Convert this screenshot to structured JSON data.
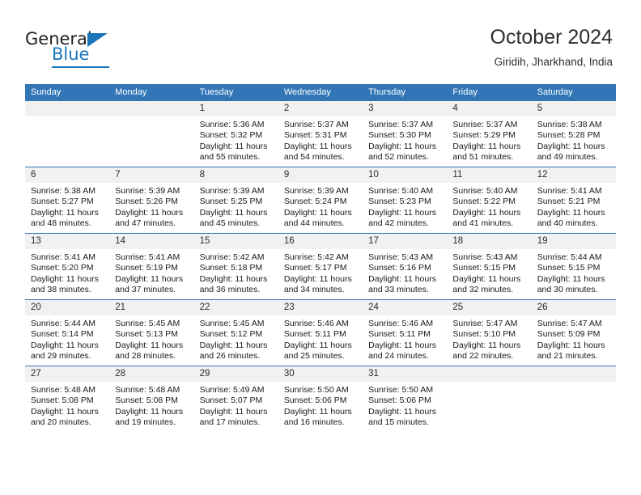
{
  "brand": {
    "name_top": "General",
    "name_bottom": "Blue",
    "accent_color": "#1b75bb"
  },
  "header": {
    "title": "October 2024",
    "subtitle": "Giridih, Jharkhand, India"
  },
  "calendar": {
    "header_bg": "#3276b8",
    "daynum_bg": "#f1f1f1",
    "weekday_headers": [
      "Sunday",
      "Monday",
      "Tuesday",
      "Wednesday",
      "Thursday",
      "Friday",
      "Saturday"
    ],
    "weeks": [
      [
        {
          "day": "",
          "sunrise": "",
          "sunset": "",
          "daylight_1": "",
          "daylight_2": ""
        },
        {
          "day": "",
          "sunrise": "",
          "sunset": "",
          "daylight_1": "",
          "daylight_2": ""
        },
        {
          "day": "1",
          "sunrise": "Sunrise: 5:36 AM",
          "sunset": "Sunset: 5:32 PM",
          "daylight_1": "Daylight: 11 hours",
          "daylight_2": "and 55 minutes."
        },
        {
          "day": "2",
          "sunrise": "Sunrise: 5:37 AM",
          "sunset": "Sunset: 5:31 PM",
          "daylight_1": "Daylight: 11 hours",
          "daylight_2": "and 54 minutes."
        },
        {
          "day": "3",
          "sunrise": "Sunrise: 5:37 AM",
          "sunset": "Sunset: 5:30 PM",
          "daylight_1": "Daylight: 11 hours",
          "daylight_2": "and 52 minutes."
        },
        {
          "day": "4",
          "sunrise": "Sunrise: 5:37 AM",
          "sunset": "Sunset: 5:29 PM",
          "daylight_1": "Daylight: 11 hours",
          "daylight_2": "and 51 minutes."
        },
        {
          "day": "5",
          "sunrise": "Sunrise: 5:38 AM",
          "sunset": "Sunset: 5:28 PM",
          "daylight_1": "Daylight: 11 hours",
          "daylight_2": "and 49 minutes."
        }
      ],
      [
        {
          "day": "6",
          "sunrise": "Sunrise: 5:38 AM",
          "sunset": "Sunset: 5:27 PM",
          "daylight_1": "Daylight: 11 hours",
          "daylight_2": "and 48 minutes."
        },
        {
          "day": "7",
          "sunrise": "Sunrise: 5:39 AM",
          "sunset": "Sunset: 5:26 PM",
          "daylight_1": "Daylight: 11 hours",
          "daylight_2": "and 47 minutes."
        },
        {
          "day": "8",
          "sunrise": "Sunrise: 5:39 AM",
          "sunset": "Sunset: 5:25 PM",
          "daylight_1": "Daylight: 11 hours",
          "daylight_2": "and 45 minutes."
        },
        {
          "day": "9",
          "sunrise": "Sunrise: 5:39 AM",
          "sunset": "Sunset: 5:24 PM",
          "daylight_1": "Daylight: 11 hours",
          "daylight_2": "and 44 minutes."
        },
        {
          "day": "10",
          "sunrise": "Sunrise: 5:40 AM",
          "sunset": "Sunset: 5:23 PM",
          "daylight_1": "Daylight: 11 hours",
          "daylight_2": "and 42 minutes."
        },
        {
          "day": "11",
          "sunrise": "Sunrise: 5:40 AM",
          "sunset": "Sunset: 5:22 PM",
          "daylight_1": "Daylight: 11 hours",
          "daylight_2": "and 41 minutes."
        },
        {
          "day": "12",
          "sunrise": "Sunrise: 5:41 AM",
          "sunset": "Sunset: 5:21 PM",
          "daylight_1": "Daylight: 11 hours",
          "daylight_2": "and 40 minutes."
        }
      ],
      [
        {
          "day": "13",
          "sunrise": "Sunrise: 5:41 AM",
          "sunset": "Sunset: 5:20 PM",
          "daylight_1": "Daylight: 11 hours",
          "daylight_2": "and 38 minutes."
        },
        {
          "day": "14",
          "sunrise": "Sunrise: 5:41 AM",
          "sunset": "Sunset: 5:19 PM",
          "daylight_1": "Daylight: 11 hours",
          "daylight_2": "and 37 minutes."
        },
        {
          "day": "15",
          "sunrise": "Sunrise: 5:42 AM",
          "sunset": "Sunset: 5:18 PM",
          "daylight_1": "Daylight: 11 hours",
          "daylight_2": "and 36 minutes."
        },
        {
          "day": "16",
          "sunrise": "Sunrise: 5:42 AM",
          "sunset": "Sunset: 5:17 PM",
          "daylight_1": "Daylight: 11 hours",
          "daylight_2": "and 34 minutes."
        },
        {
          "day": "17",
          "sunrise": "Sunrise: 5:43 AM",
          "sunset": "Sunset: 5:16 PM",
          "daylight_1": "Daylight: 11 hours",
          "daylight_2": "and 33 minutes."
        },
        {
          "day": "18",
          "sunrise": "Sunrise: 5:43 AM",
          "sunset": "Sunset: 5:15 PM",
          "daylight_1": "Daylight: 11 hours",
          "daylight_2": "and 32 minutes."
        },
        {
          "day": "19",
          "sunrise": "Sunrise: 5:44 AM",
          "sunset": "Sunset: 5:15 PM",
          "daylight_1": "Daylight: 11 hours",
          "daylight_2": "and 30 minutes."
        }
      ],
      [
        {
          "day": "20",
          "sunrise": "Sunrise: 5:44 AM",
          "sunset": "Sunset: 5:14 PM",
          "daylight_1": "Daylight: 11 hours",
          "daylight_2": "and 29 minutes."
        },
        {
          "day": "21",
          "sunrise": "Sunrise: 5:45 AM",
          "sunset": "Sunset: 5:13 PM",
          "daylight_1": "Daylight: 11 hours",
          "daylight_2": "and 28 minutes."
        },
        {
          "day": "22",
          "sunrise": "Sunrise: 5:45 AM",
          "sunset": "Sunset: 5:12 PM",
          "daylight_1": "Daylight: 11 hours",
          "daylight_2": "and 26 minutes."
        },
        {
          "day": "23",
          "sunrise": "Sunrise: 5:46 AM",
          "sunset": "Sunset: 5:11 PM",
          "daylight_1": "Daylight: 11 hours",
          "daylight_2": "and 25 minutes."
        },
        {
          "day": "24",
          "sunrise": "Sunrise: 5:46 AM",
          "sunset": "Sunset: 5:11 PM",
          "daylight_1": "Daylight: 11 hours",
          "daylight_2": "and 24 minutes."
        },
        {
          "day": "25",
          "sunrise": "Sunrise: 5:47 AM",
          "sunset": "Sunset: 5:10 PM",
          "daylight_1": "Daylight: 11 hours",
          "daylight_2": "and 22 minutes."
        },
        {
          "day": "26",
          "sunrise": "Sunrise: 5:47 AM",
          "sunset": "Sunset: 5:09 PM",
          "daylight_1": "Daylight: 11 hours",
          "daylight_2": "and 21 minutes."
        }
      ],
      [
        {
          "day": "27",
          "sunrise": "Sunrise: 5:48 AM",
          "sunset": "Sunset: 5:08 PM",
          "daylight_1": "Daylight: 11 hours",
          "daylight_2": "and 20 minutes."
        },
        {
          "day": "28",
          "sunrise": "Sunrise: 5:48 AM",
          "sunset": "Sunset: 5:08 PM",
          "daylight_1": "Daylight: 11 hours",
          "daylight_2": "and 19 minutes."
        },
        {
          "day": "29",
          "sunrise": "Sunrise: 5:49 AM",
          "sunset": "Sunset: 5:07 PM",
          "daylight_1": "Daylight: 11 hours",
          "daylight_2": "and 17 minutes."
        },
        {
          "day": "30",
          "sunrise": "Sunrise: 5:50 AM",
          "sunset": "Sunset: 5:06 PM",
          "daylight_1": "Daylight: 11 hours",
          "daylight_2": "and 16 minutes."
        },
        {
          "day": "31",
          "sunrise": "Sunrise: 5:50 AM",
          "sunset": "Sunset: 5:06 PM",
          "daylight_1": "Daylight: 11 hours",
          "daylight_2": "and 15 minutes."
        },
        {
          "day": "",
          "sunrise": "",
          "sunset": "",
          "daylight_1": "",
          "daylight_2": ""
        },
        {
          "day": "",
          "sunrise": "",
          "sunset": "",
          "daylight_1": "",
          "daylight_2": ""
        }
      ]
    ]
  }
}
